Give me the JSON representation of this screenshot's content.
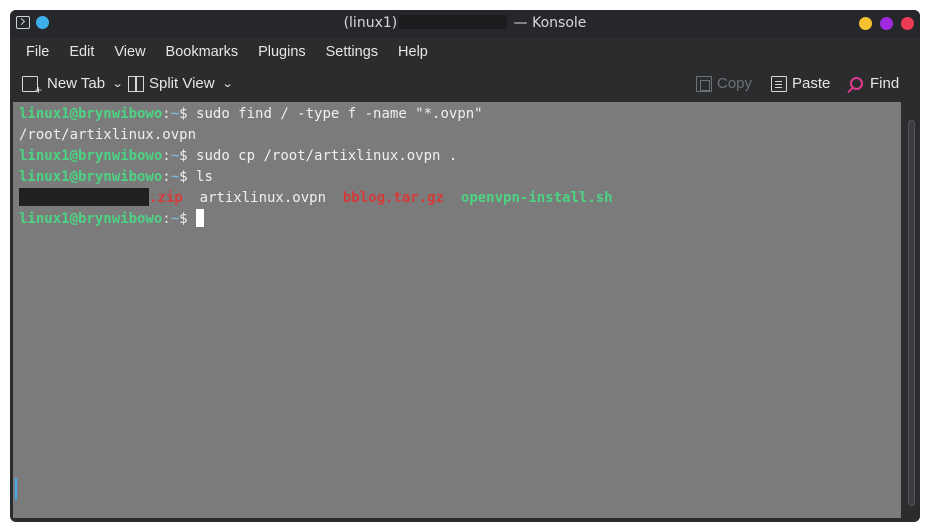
{
  "window": {
    "title_left": "(linux1)",
    "title_right": " — Konsole",
    "controls": [
      {
        "name": "minimize",
        "color": "#f6c230"
      },
      {
        "name": "maximize",
        "color": "#a12ae0"
      },
      {
        "name": "close",
        "color": "#ed3b53"
      }
    ]
  },
  "menu": [
    "File",
    "Edit",
    "View",
    "Bookmarks",
    "Plugins",
    "Settings",
    "Help"
  ],
  "toolbar": {
    "new_tab": "New Tab",
    "split_view": "Split View",
    "copy": "Copy",
    "paste": "Paste",
    "find": "Find"
  },
  "terminal": {
    "prompt_user": "linux1@brynwibowo",
    "prompt_sep": ":",
    "prompt_dir": "~",
    "prompt_sym": "$ ",
    "lines": [
      {
        "type": "cmd",
        "text": "sudo find / -type f -name \"*.ovpn\""
      },
      {
        "type": "out",
        "text": "/root/artixlinux.ovpn"
      },
      {
        "type": "cmd",
        "text": "sudo cp /root/artixlinux.ovpn ."
      },
      {
        "type": "cmd",
        "text": "ls"
      }
    ],
    "ls_items": [
      {
        "text": ".zip",
        "style": "red"
      },
      {
        "text": "artixlinux.ovpn",
        "style": "plain"
      },
      {
        "text": "bblog.tar.gz",
        "style": "red"
      },
      {
        "text": "openvpn-install.sh",
        "style": "green"
      }
    ]
  },
  "colors": {
    "terminal_bg": "#7b7b7b",
    "prompt_green": "#4cd383",
    "archive_red": "#d43b3b",
    "accent_blue": "#3daee9",
    "find_pink": "#e0388f"
  }
}
